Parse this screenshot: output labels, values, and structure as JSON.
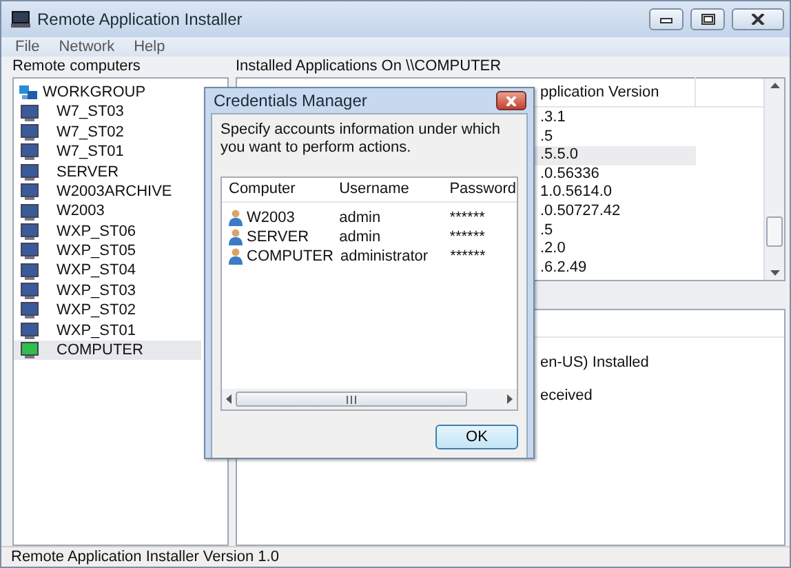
{
  "window": {
    "title": "Remote Application Installer"
  },
  "menu": [
    {
      "label": "File"
    },
    {
      "label": "Network"
    },
    {
      "label": "Help"
    }
  ],
  "left_panel": {
    "label": "Remote computers",
    "tree": [
      {
        "label": "WORKGROUP",
        "kind": "group",
        "children": [
          {
            "label": "W7_ST03",
            "kind": "remote",
            "selected": false
          },
          {
            "label": "W7_ST02",
            "kind": "remote",
            "selected": false
          },
          {
            "label": "W7_ST01",
            "kind": "remote",
            "selected": false
          },
          {
            "label": "SERVER",
            "kind": "remote",
            "selected": false
          },
          {
            "label": "W2003ARCHIVE",
            "kind": "remote",
            "selected": false
          },
          {
            "label": "W2003",
            "kind": "remote",
            "selected": false
          },
          {
            "label": "WXP_ST06",
            "kind": "remote",
            "selected": false
          },
          {
            "label": "WXP_ST05",
            "kind": "remote",
            "selected": false
          },
          {
            "label": "WXP_ST04",
            "kind": "remote",
            "selected": false
          },
          {
            "label": "WXP_ST03",
            "kind": "remote",
            "selected": false
          },
          {
            "label": "WXP_ST02",
            "kind": "remote",
            "selected": false
          },
          {
            "label": "WXP_ST01",
            "kind": "remote",
            "selected": false
          },
          {
            "label": "COMPUTER",
            "kind": "local",
            "selected": true
          }
        ]
      }
    ]
  },
  "right_panel": {
    "label": "Installed Applications On \\\\COMPUTER",
    "applications": {
      "column": "pplication Version",
      "rows": [
        {
          "version": ".3.1",
          "selected": false
        },
        {
          "version": ".5",
          "selected": false
        },
        {
          "version": ".5.5.0",
          "selected": true
        },
        {
          "version": ".0.56336",
          "selected": false
        },
        {
          "version": "1.0.5614.0",
          "selected": false
        },
        {
          "version": ".0.50727.42",
          "selected": false
        },
        {
          "version": ".5",
          "selected": false
        },
        {
          "version": ".2.0",
          "selected": false
        },
        {
          "version": ".6.2.49",
          "selected": false
        }
      ]
    },
    "details": {
      "lines": [
        "en-US) Installed",
        "eceived"
      ]
    }
  },
  "dialog": {
    "title": "Credentials Manager",
    "message": "Specify accounts information under which you want to perform actions.",
    "columns": [
      "Computer",
      "Username",
      "Password"
    ],
    "rows": [
      {
        "computer": "W2003",
        "username": "admin",
        "password": "******"
      },
      {
        "computer": "SERVER",
        "username": "admin",
        "password": "******"
      },
      {
        "computer": "COMPUTER",
        "username": "administrator",
        "password": "******"
      }
    ],
    "buttons": [
      "OK"
    ]
  },
  "status_bar": "Remote Application Installer Version 1.0"
}
